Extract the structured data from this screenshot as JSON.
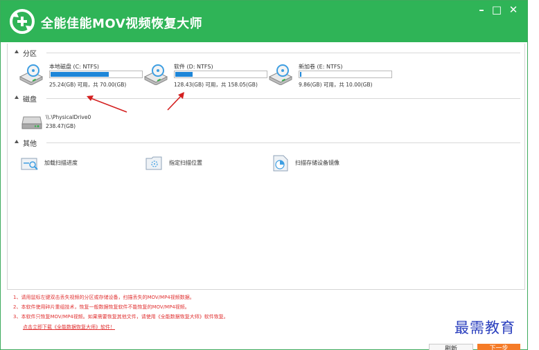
{
  "window": {
    "title": "全能佳能MOV视频恢复大师",
    "controls": {
      "minimize": "–",
      "maximize": "□",
      "close": "✕"
    }
  },
  "sections": {
    "partition": "分区",
    "disk": "磁盘",
    "other": "其他"
  },
  "drives": [
    {
      "name": "本地磁盘 (C: NTFS)",
      "info": "25.24(GB) 可用，共 70.00(GB)",
      "used_fraction": 0.64
    },
    {
      "name": "软件 (D: NTFS)",
      "info": "128.43(GB) 可用，共 158.05(GB)",
      "used_fraction": 0.19
    },
    {
      "name": "新加卷 (E: NTFS)",
      "info": "9.86(GB) 可用，共 10.00(GB)",
      "used_fraction": 0.014
    }
  ],
  "physical_disks": [
    {
      "name": "\\\\.\\PhysicalDrive0",
      "size": "238.47(GB)"
    }
  ],
  "actions": [
    {
      "label": "加载扫描进度",
      "icon": "load-progress-icon"
    },
    {
      "label": "指定扫描位置",
      "icon": "target-location-icon"
    },
    {
      "label": "扫描存储设备镜像",
      "icon": "disk-image-icon"
    }
  ],
  "notes": [
    "1、请用鼠标左键双击丢失视频的分区或存储设备，扫描丢失的MOV/MP4视频数据。",
    "2、本软件使用碎片重组技术，恢复一般数据恢复软件不能恢复的MOV/MP4视频。",
    "3、本软件只恢复MOV/MP4视频。如果需要恢复其他文件，请使用《全能数据恢复大师》软件恢复。"
  ],
  "download_link": "点击立即下载《全能数据恢复大师》软件！",
  "buttons": {
    "refresh": "刷新",
    "next": "下一步"
  },
  "watermark": "最需教育",
  "colors": {
    "titlebar": "#2fb457",
    "progress": "#1e86d8",
    "note_text": "#e03030",
    "next_button": "#f57b27",
    "arrow": "#d42020"
  }
}
